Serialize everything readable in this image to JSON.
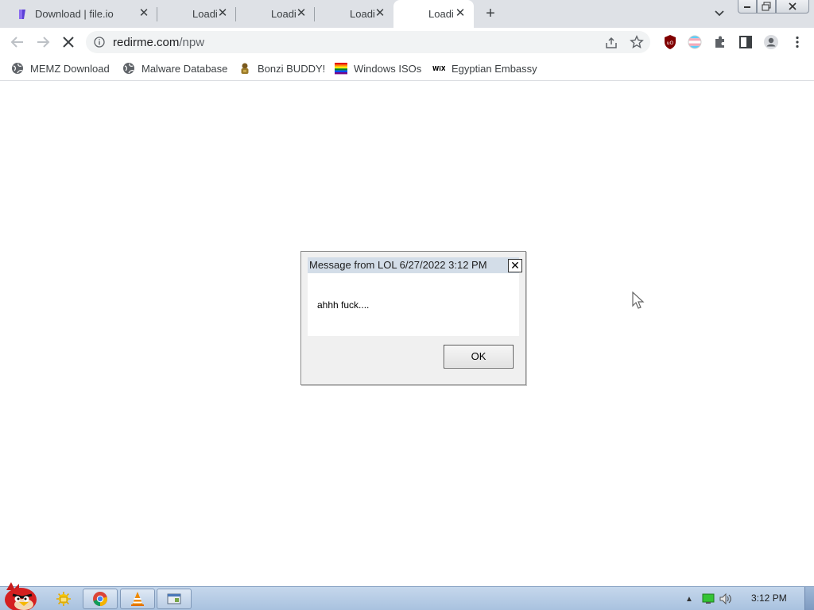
{
  "window": {
    "tabs": [
      {
        "title": "Download | file.io",
        "active": false
      },
      {
        "title": "Loadi",
        "active": false
      },
      {
        "title": "Loadi",
        "active": false
      },
      {
        "title": "Loadi",
        "active": false
      },
      {
        "title": "Loadi",
        "active": true
      }
    ],
    "new_tab_icon": "plus-icon",
    "tab_search_icon": "chevron-down-icon"
  },
  "toolbar": {
    "url_host": "redirme.com",
    "url_path": "/npw",
    "extensions": [
      "ublock-origin-icon",
      "trans-flag-extension-icon",
      "puzzle-icon",
      "side-panel-icon",
      "profile-icon",
      "kebab-menu-icon"
    ]
  },
  "bookmarks": [
    {
      "label": "MEMZ Download",
      "icon": "globe-icon"
    },
    {
      "label": "Malware Database",
      "icon": "globe-icon"
    },
    {
      "label": "Bonzi BUDDY!",
      "icon": "bonzi-icon"
    },
    {
      "label": "Windows ISOs",
      "icon": "rainbow-flag-icon"
    },
    {
      "label": "Egyptian Embassy",
      "icon": "wix-icon"
    }
  ],
  "dialog": {
    "title": "Message from LOL 6/27/2022 3:12 PM",
    "close_label": "✕",
    "message": "ahhh fuck....",
    "ok_label": "OK"
  },
  "taskbar": {
    "start_icon": "angry-bird-icon",
    "apps": [
      "explorer-folder-icon",
      "chrome-icon",
      "vlc-icon",
      "window-app-icon"
    ],
    "tray": [
      "show-hidden-icons-icon",
      "network-icon",
      "volume-icon"
    ],
    "time": "3:12 PM"
  }
}
